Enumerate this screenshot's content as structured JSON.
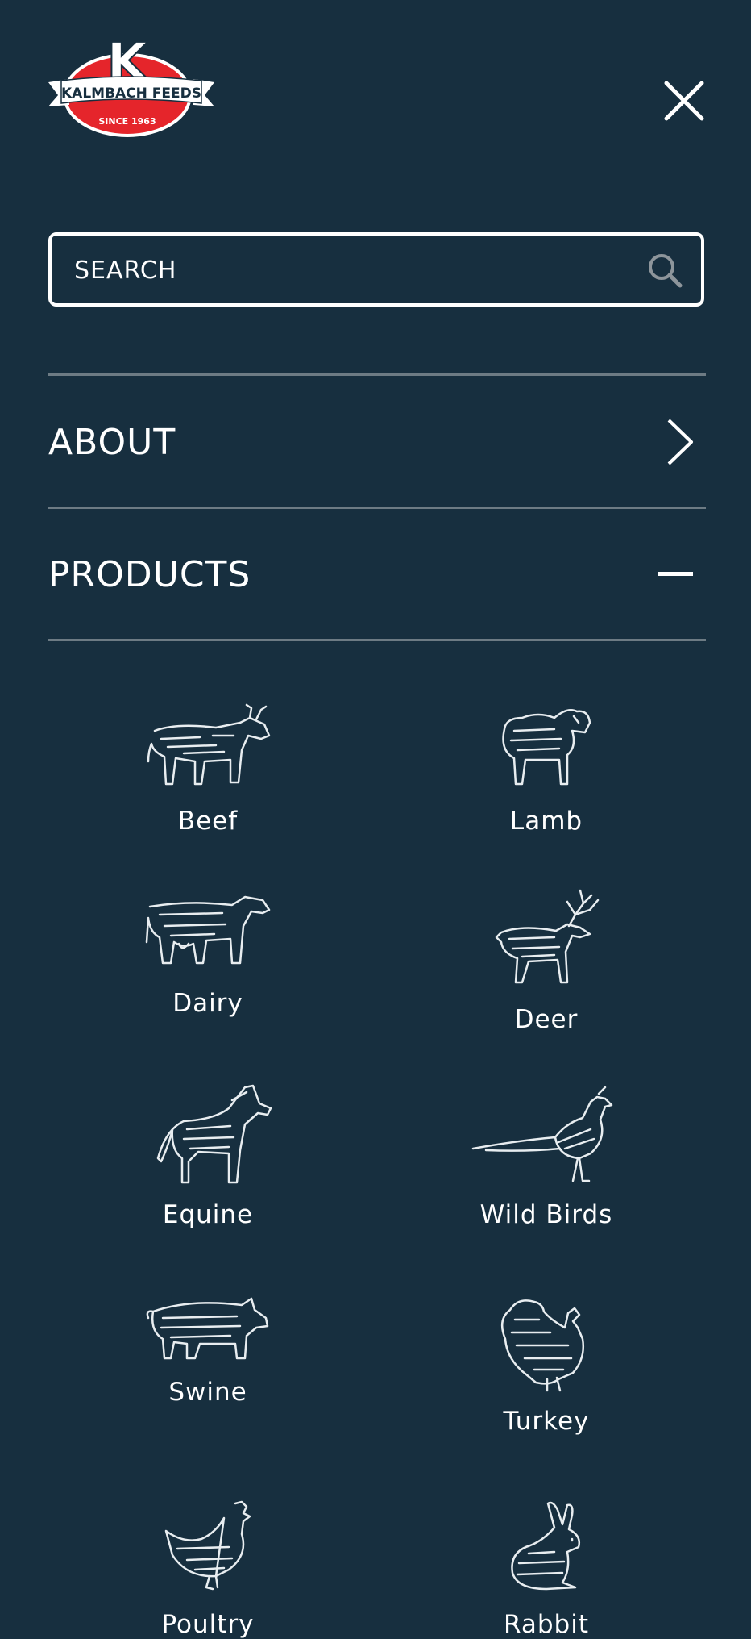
{
  "brand": {
    "initial": "K",
    "name": "KALMBACH FEEDS",
    "tagline": "SINCE 1963",
    "colors": {
      "red": "#e5252b",
      "navy": "#172f3f",
      "white": "#ffffff"
    }
  },
  "header": {
    "close_icon": "close-icon"
  },
  "search": {
    "placeholder": "SEARCH",
    "value": "",
    "icon": "search-icon"
  },
  "nav": {
    "about": {
      "label": "ABOUT",
      "icon": "chevron-right-icon"
    },
    "products": {
      "label": "PRODUCTS",
      "icon": "minus-icon",
      "expanded": true
    }
  },
  "products": [
    {
      "label": "Beef",
      "icon": "cow-icon"
    },
    {
      "label": "Lamb",
      "icon": "sheep-icon"
    },
    {
      "label": "Dairy",
      "icon": "dairy-cow-icon"
    },
    {
      "label": "Deer",
      "icon": "deer-icon"
    },
    {
      "label": "Equine",
      "icon": "horse-icon"
    },
    {
      "label": "Wild Birds",
      "icon": "pheasant-icon"
    },
    {
      "label": "Swine",
      "icon": "pig-icon"
    },
    {
      "label": "Turkey",
      "icon": "turkey-icon"
    },
    {
      "label": "Poultry",
      "icon": "chicken-icon"
    },
    {
      "label": "Rabbit",
      "icon": "rabbit-icon"
    }
  ]
}
